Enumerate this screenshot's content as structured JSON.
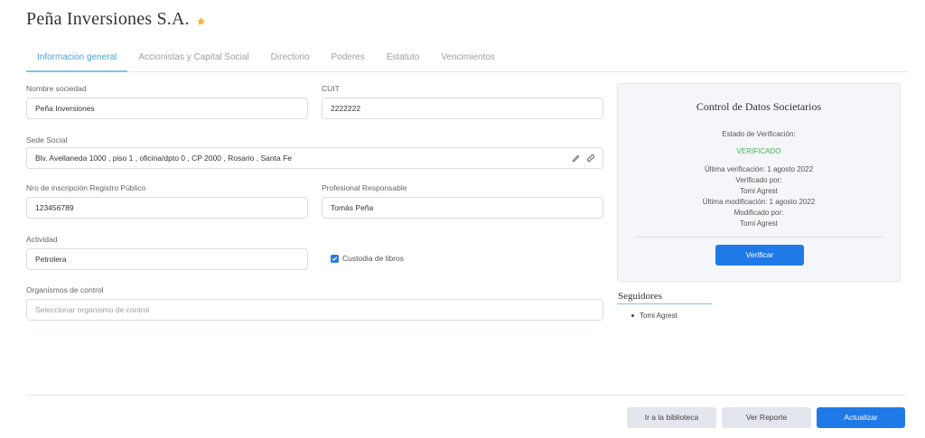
{
  "page": {
    "title": "Peña Inversiones S.A."
  },
  "tabs": [
    {
      "label": "Informacion general",
      "active": true
    },
    {
      "label": "Accionistas y Capital Social",
      "active": false
    },
    {
      "label": "Directorio",
      "active": false
    },
    {
      "label": "Poderes",
      "active": false
    },
    {
      "label": "Estatuto",
      "active": false
    },
    {
      "label": "Vencimientos",
      "active": false
    }
  ],
  "form": {
    "nombre_sociedad": {
      "label": "Nombre sociedad",
      "value": "Peña Inversiones"
    },
    "cuit": {
      "label": "CUIT",
      "value": "2222222"
    },
    "sede_social": {
      "label": "Sede Social",
      "value": "Blv. Avellaneda 1000 , piso 1 , oficina/dpto 0 , CP 2000 , Rosario , Santa Fe"
    },
    "nro_inscripcion": {
      "label": "Nro de inscripción Registro Público",
      "value": "123456789"
    },
    "profesional": {
      "label": "Profesional Responsable",
      "value": "Tomás Peña"
    },
    "actividad": {
      "label": "Actividad",
      "value": "Petrolera"
    },
    "custodia": {
      "label": "Custodia de libros",
      "checked": true
    },
    "organismos": {
      "label": "Organismos de control",
      "placeholder": "Seleccionar organismo de control"
    }
  },
  "control_panel": {
    "title": "Control de Datos Societarios",
    "estado_label": "Estado de Verificación:",
    "estado_value": "VERIFICADO",
    "ultima_verificacion": "Última verificación: 1 agosto 2022",
    "verificado_por_label": "Verificado por:",
    "verificado_por": "Tomi Agrest",
    "ultima_modificacion": "Última modificación: 1 agosto 2022",
    "modificado_por_label": "Modificado por:",
    "modificado_por": "Tomi Agrest",
    "verify_button": "Verificar"
  },
  "followers": {
    "title": "Seguidores",
    "items": [
      "Tomi Agrest"
    ]
  },
  "footer": {
    "library_button": "Ir a la biblioteca",
    "report_button": "Ver Reporte",
    "update_button": "Actualizar"
  },
  "colors": {
    "accent": "#1f7ae8",
    "tab_active": "#4aa3df",
    "verified": "#4caf50",
    "star": "#f0b43c"
  }
}
